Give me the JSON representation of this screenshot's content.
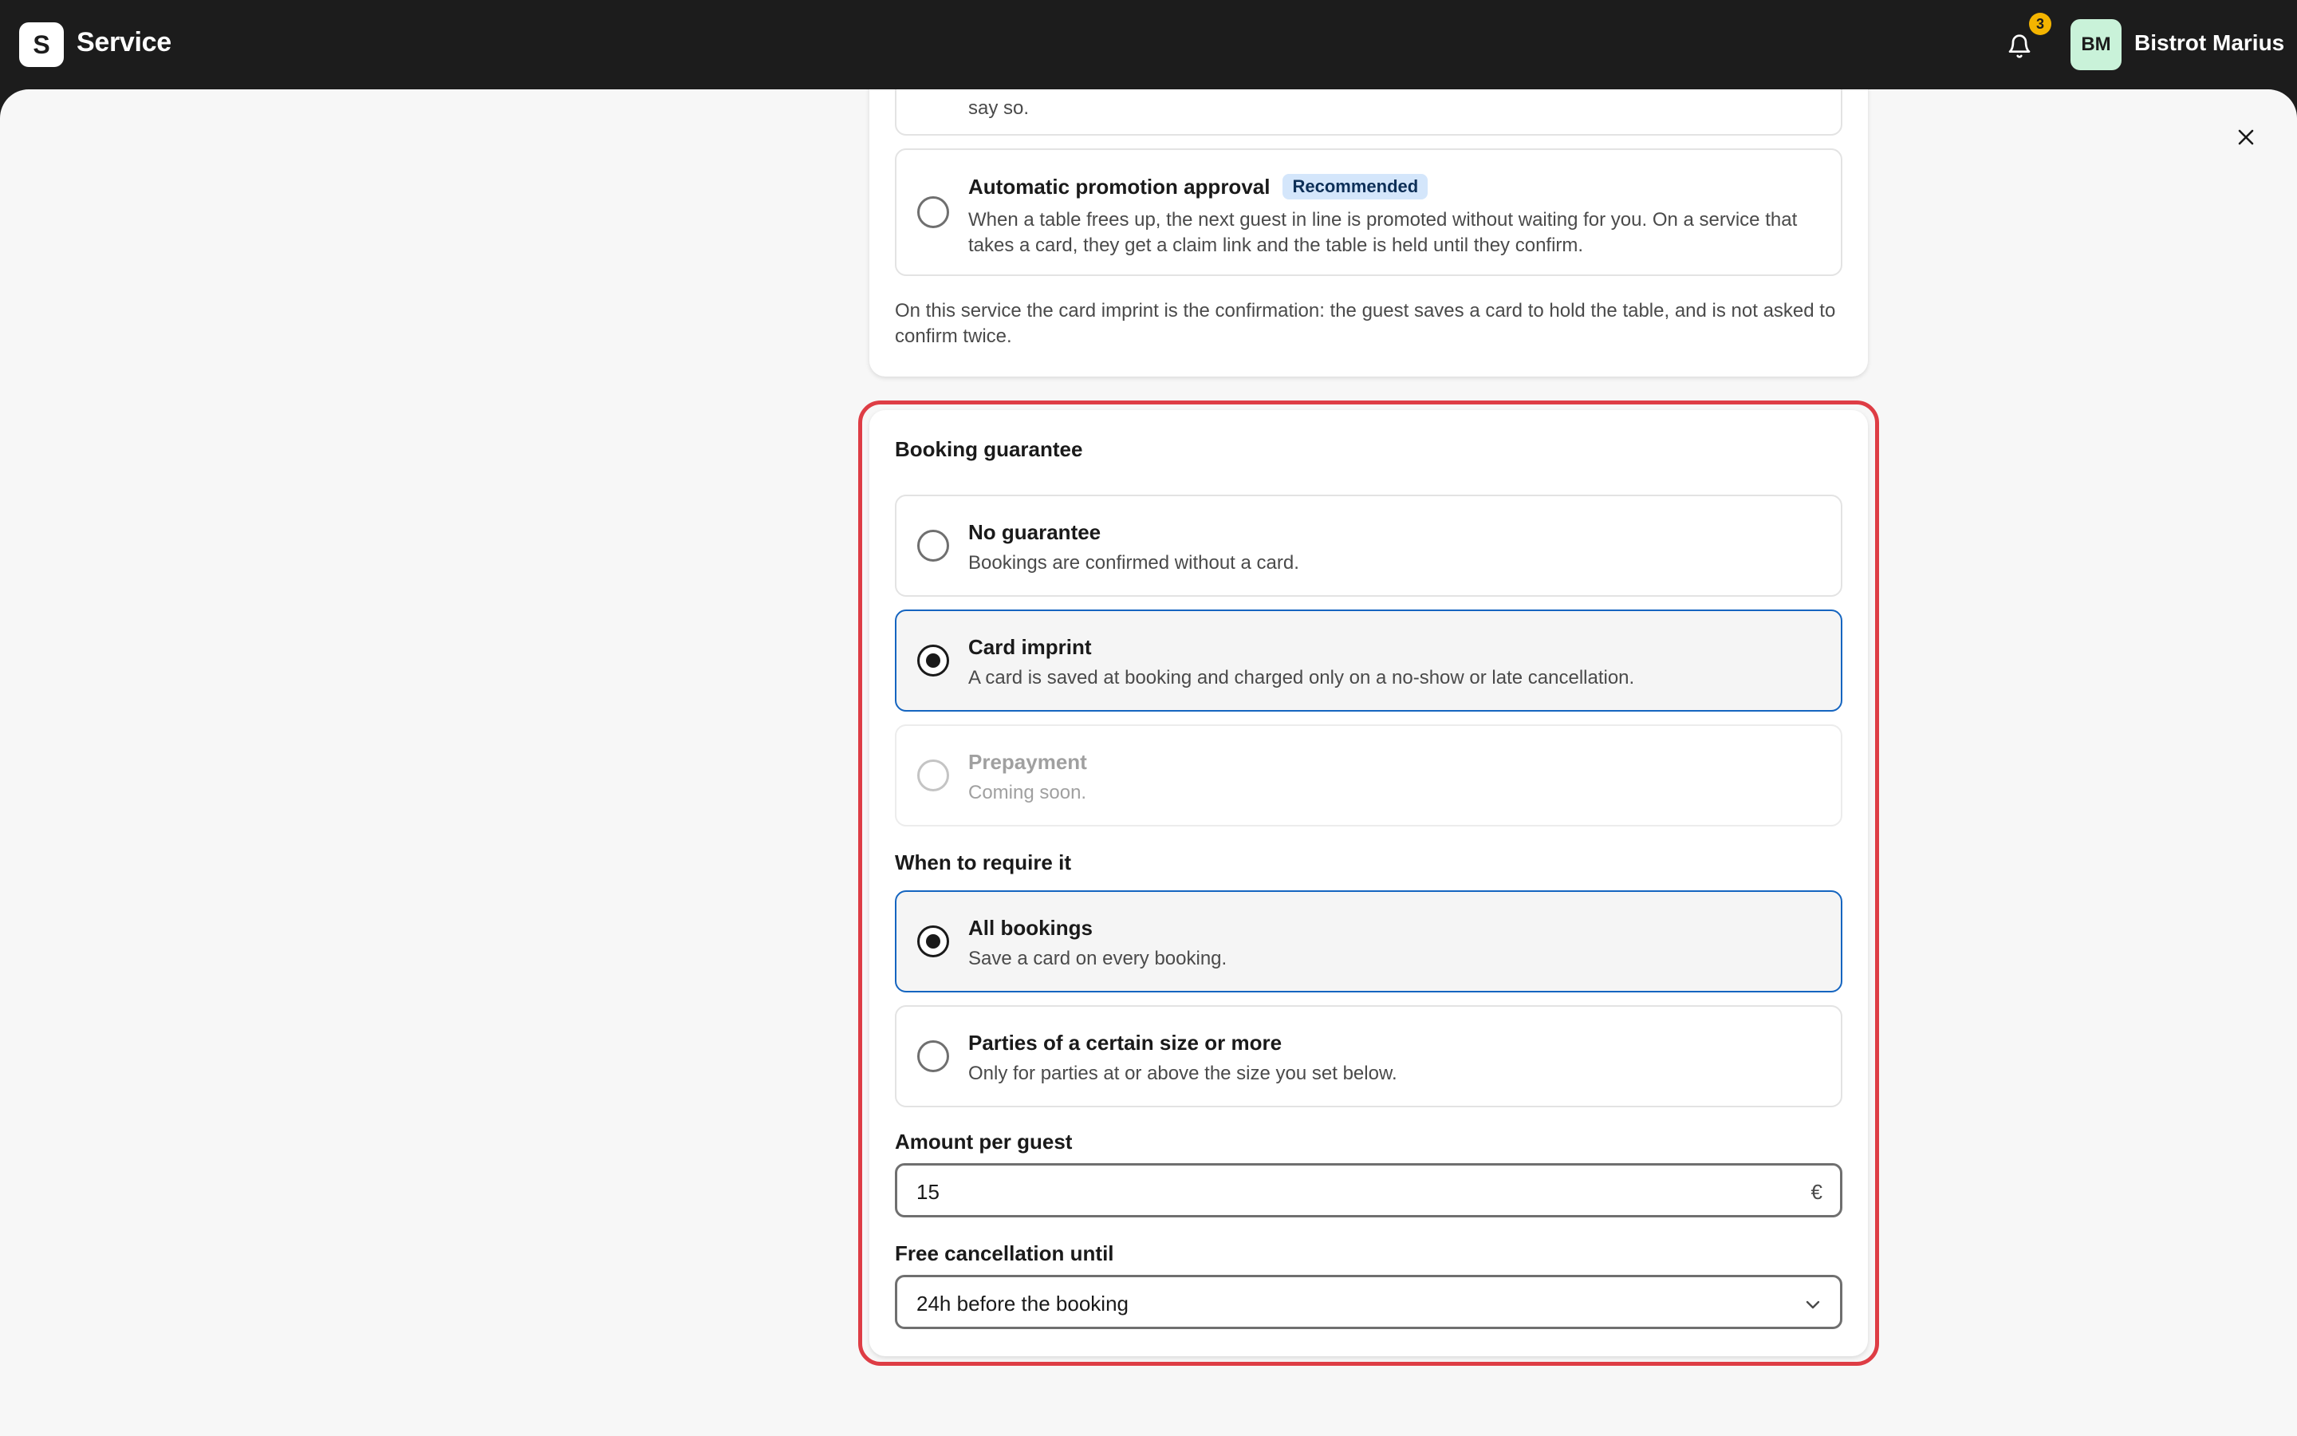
{
  "header": {
    "logo_letter": "S",
    "title": "Service",
    "notifications_count": "3",
    "avatar_initials": "BM",
    "account_name": "Bistrot Marius"
  },
  "upper_card": {
    "previous_option_desc_tail": "say so.",
    "auto_promotion": {
      "title": "Automatic promotion approval",
      "badge": "Recommended",
      "desc_line1": "When a table frees up, the next guest in line is promoted without waiting for you. On a service that",
      "desc_line2": "takes a card, they get a claim link and the table is held until they confirm.",
      "selected": false
    },
    "note_line1": "On this service the card imprint is the confirmation: the guest saves a card to hold the table, and is not asked to",
    "note_line2": "confirm twice."
  },
  "guarantee": {
    "heading": "Booking guarantee",
    "options": [
      {
        "title": "No guarantee",
        "desc": "Bookings are confirmed without a card.",
        "selected": false,
        "disabled": false
      },
      {
        "title": "Card imprint",
        "desc": "A card is saved at booking and charged only on a no-show or late cancellation.",
        "selected": true,
        "disabled": false
      },
      {
        "title": "Prepayment",
        "desc": "Coming soon.",
        "selected": false,
        "disabled": true
      }
    ],
    "when_heading": "When to require it",
    "when_options": [
      {
        "title": "All bookings",
        "desc": "Save a card on every booking.",
        "selected": true
      },
      {
        "title": "Parties of a certain size or more",
        "desc": "Only for parties at or above the size you set below.",
        "selected": false
      }
    ],
    "amount_label": "Amount per guest",
    "amount_value": "15",
    "amount_currency": "€",
    "cancellation_label": "Free cancellation until",
    "cancellation_value": "24h before the booking"
  },
  "colors": {
    "accent_blue": "#1565c0",
    "highlight_red": "#de3d45",
    "badge_bg": "#d4e6fb",
    "notification_badge": "#f4b400",
    "avatar_bg": "#c9f2d9"
  }
}
